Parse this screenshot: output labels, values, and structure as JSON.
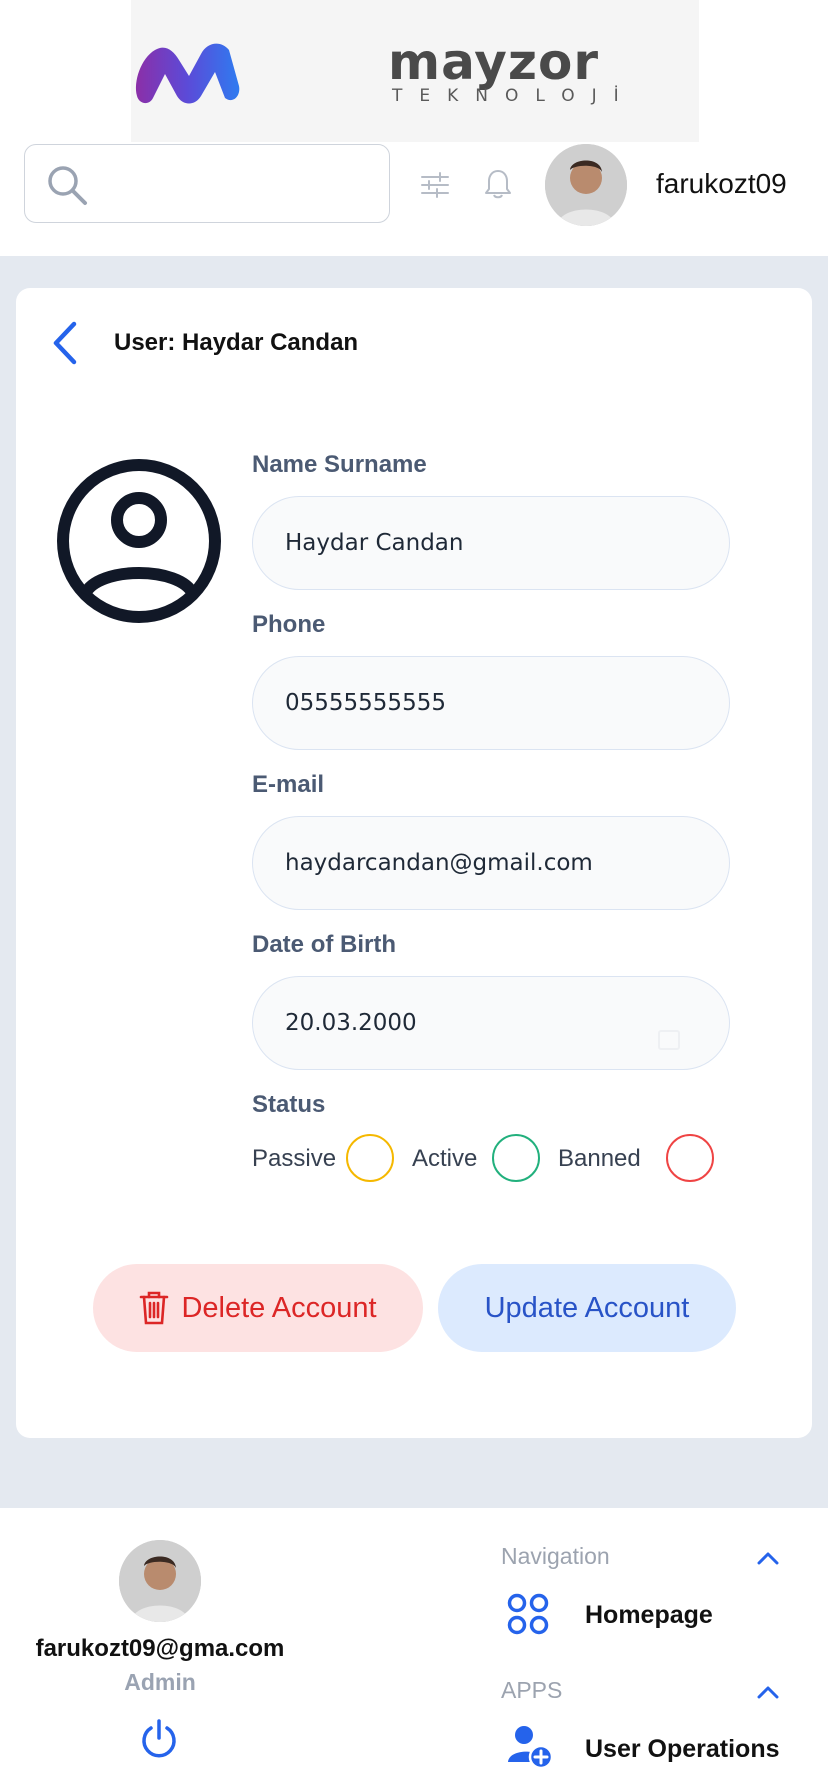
{
  "header": {
    "logo": {
      "name": "mayzor",
      "subtitle": "TEKNOLOJİ"
    },
    "search": {
      "placeholder": "",
      "value": ""
    },
    "username": "farukozt09"
  },
  "card": {
    "title": "User: Haydar Candan",
    "fields": {
      "name_label": "Name Surname",
      "name_value": "Haydar Candan",
      "phone_label": "Phone",
      "phone_value": "05555555555",
      "email_label": "E-mail",
      "email_value": "haydarcandan@gmail.com",
      "dob_label": "Date of Birth",
      "dob_value": "20.03.2000"
    },
    "status": {
      "label": "Status",
      "options": [
        {
          "label": "Passive",
          "color": "#f5b800",
          "selected": false
        },
        {
          "label": "Active",
          "color": "#22b07d",
          "selected": false
        },
        {
          "label": "Banned",
          "color": "#ef4444",
          "selected": false
        }
      ]
    },
    "buttons": {
      "delete_label": "Delete Account",
      "update_label": "Update Account"
    }
  },
  "footer": {
    "email": "farukozt09@gma.com",
    "role": "Admin",
    "navigation_label": "Navigation",
    "homepage_label": "Homepage",
    "apps_label": "APPS",
    "user_operations_label": "User Operations"
  },
  "colors": {
    "accent": "#2563eb",
    "delete_bg": "#fde2e2",
    "delete_text": "#dc2626",
    "update_bg": "#dceafe",
    "update_text": "#2853c7",
    "page_bg": "#e4e9f0"
  }
}
